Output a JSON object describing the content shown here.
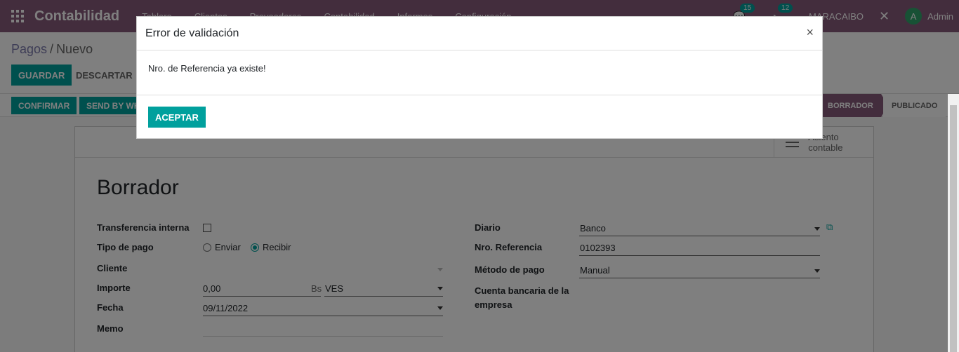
{
  "nav": {
    "app_name": "Contabilidad",
    "menu": [
      "Tablero",
      "Clientes",
      "Proveedores",
      "Contabilidad",
      "Informes",
      "Configuración"
    ],
    "messages_badge": "15",
    "activity_badge": "12",
    "company": "MARACAIBO",
    "avatar_letter": "A",
    "user": "Admin"
  },
  "breadcrumb": {
    "parent": "Pagos",
    "separator": "/",
    "current": "Nuevo"
  },
  "actions": {
    "save": "GUARDAR",
    "discard": "DESCARTAR"
  },
  "statusbar": {
    "confirm": "CONFIRMAR",
    "whatsapp": "SEND BY WHATSAPP",
    "stages": [
      "BORRADOR",
      "PUBLICADO"
    ],
    "active_stage": "BORRADOR"
  },
  "sheet": {
    "smart_button": "Asiento contable",
    "state_title": "Borrador",
    "left": {
      "internal_transfer_label": "Transferencia interna",
      "payment_type_label": "Tipo de pago",
      "payment_type_options": [
        "Enviar",
        "Recibir"
      ],
      "payment_type_selected": "Recibir",
      "customer_label": "Cliente",
      "customer_value": "",
      "amount_label": "Importe",
      "amount_value": "0,00",
      "currency_symbol": "Bs",
      "currency": "VES",
      "date_label": "Fecha",
      "date_value": "09/11/2022",
      "memo_label": "Memo",
      "memo_value": ""
    },
    "right": {
      "journal_label": "Diario",
      "journal_value": "Banco",
      "ref_label": "Nro. Referencia",
      "ref_value": "0102393",
      "method_label": "Método de pago",
      "method_value": "Manual",
      "bank_account_label": "Cuenta bancaria de la empresa"
    }
  },
  "modal": {
    "title": "Error de validación",
    "close": "×",
    "message": "Nro. de Referencia ya existe!",
    "accept": "ACEPTAR"
  },
  "colors": {
    "brand": "#875a7b",
    "accent": "#00a09d"
  }
}
